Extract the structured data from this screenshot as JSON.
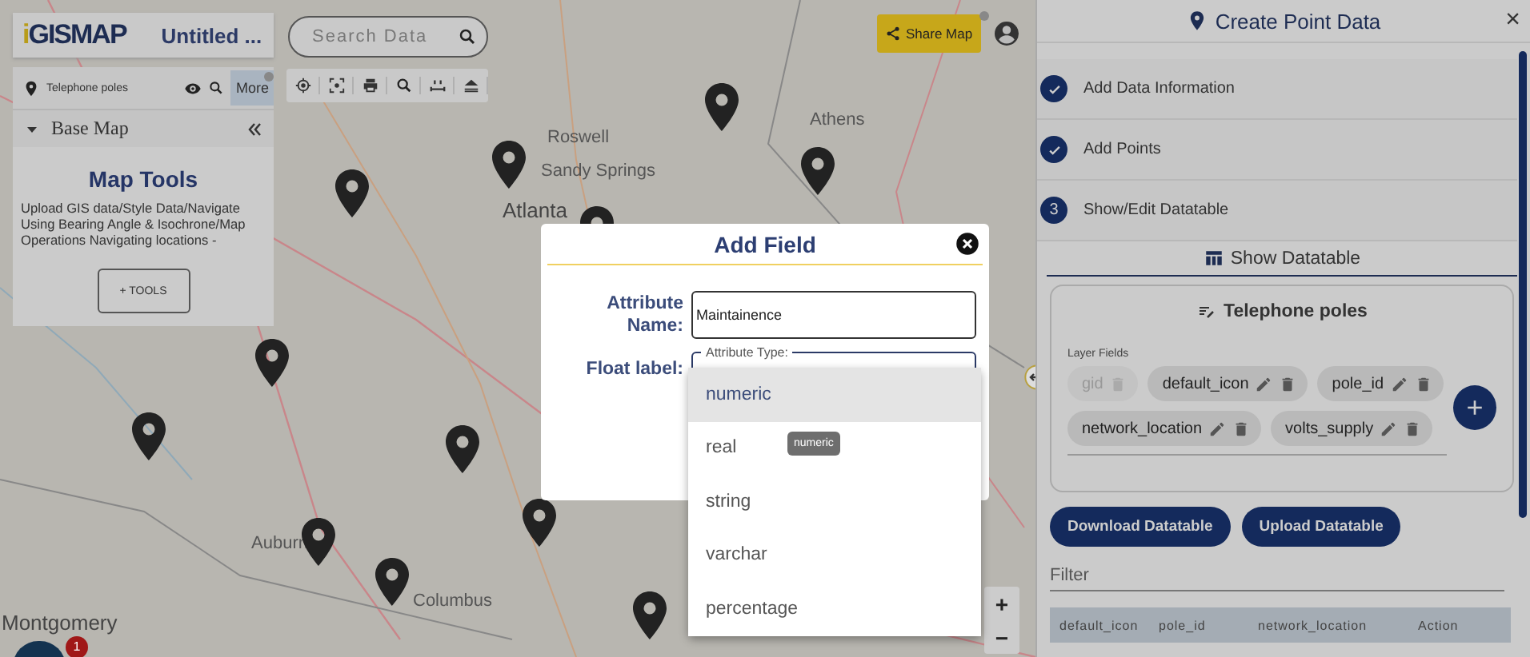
{
  "left_panel": {
    "logo": "iGISMAP",
    "map_title": "Untitled ...",
    "layer": {
      "name": "Telephone poles",
      "more": "More"
    },
    "base_map": {
      "label": "Base Map",
      "expanded": true
    },
    "map_tools": {
      "title": "Map Tools",
      "description": "Upload GIS data/Style Data/Navigate Using Bearing Angle & Isochrone/Map Operations Navigating locations -",
      "button": "+ TOOLS"
    }
  },
  "search": {
    "placeholder": "Search Data"
  },
  "share_button": "Share Map",
  "map_labels": [
    "Roswell",
    "Sandy Springs",
    "Atlanta",
    "Athens",
    "Auburn",
    "Columbus",
    "Montgomery"
  ],
  "cluster": {
    "badge": "1"
  },
  "zoom": {
    "in": "+",
    "out": "−"
  },
  "dialog": {
    "title": "Add Field",
    "attribute_name_label": "Attribute Name:",
    "attribute_name_value": "Maintainence",
    "float_label": "Float label:",
    "type_label": "Attribute Type:",
    "options": [
      {
        "label": "numeric",
        "selected": true
      },
      {
        "label": "real",
        "selected": false
      },
      {
        "label": "string",
        "selected": false
      },
      {
        "label": "varchar",
        "selected": false
      },
      {
        "label": "percentage",
        "selected": false
      }
    ],
    "tooltip": "numeric"
  },
  "right_panel": {
    "title": "Create Point Data",
    "close": "×",
    "steps": [
      {
        "kind": "done",
        "label": "Add Data Information"
      },
      {
        "kind": "done",
        "label": "Add Points"
      },
      {
        "kind": "number",
        "number": "3",
        "label": "Show/Edit Datatable"
      }
    ],
    "datatable_tab": "Show Datatable",
    "layer_card": {
      "title": "Telephone poles",
      "fields_label": "Layer Fields",
      "fields": [
        {
          "name": "gid",
          "disabled": true
        },
        {
          "name": "default_icon",
          "disabled": false
        },
        {
          "name": "pole_id",
          "disabled": false
        },
        {
          "name": "network_location",
          "disabled": false
        },
        {
          "name": "volts_supply",
          "disabled": false
        }
      ],
      "add": "+"
    },
    "buttons": [
      "Download Datatable",
      "Upload Datatable"
    ],
    "filter": {
      "placeholder": "Filter"
    },
    "table": {
      "columns": [
        "default_icon",
        "pole_id",
        "network_location",
        "Action"
      ]
    }
  }
}
